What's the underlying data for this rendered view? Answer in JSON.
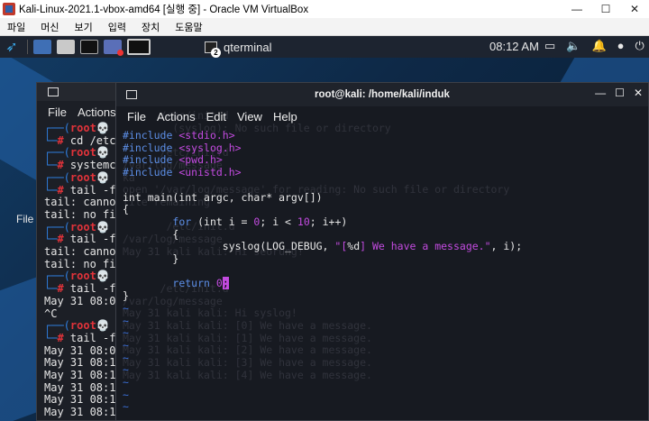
{
  "host": {
    "title": "Kali-Linux-2021.1-vbox-amd64 [실행 중] - Oracle VM VirtualBox",
    "controls": [
      "—",
      "☐",
      "✕"
    ]
  },
  "vbox_menu": [
    "파일",
    "머신",
    "보기",
    "입력",
    "장치",
    "도움말"
  ],
  "panel": {
    "task_label": "qterminal",
    "task_count": "2",
    "clock": "08:12 AM"
  },
  "desktop": {
    "label": "File"
  },
  "back_terminal": {
    "menu": [
      "File",
      "Actions"
    ],
    "lines": [
      "┌──(root💀 ka",
      "└─# cd /etc/",
      "┌──(root💀 ka",
      "└─# systemct",
      "┌──(root💀 ka",
      "└─# tail -f",
      "tail: cannot",
      "tail: no fil",
      "┌──(root💀 ka",
      "└─# tail -f",
      "tail: cannot",
      "tail: no fil",
      "┌──(root💀 ka",
      "└─# tail -f",
      "May 31 08:06",
      "^C",
      "┌──(root💀 ka",
      "└─# tail -f",
      "May 31 08:06",
      "May 31 08:11",
      "May 31 08:11",
      "May 31 08:11",
      "May 31 08:11",
      "May 31 08:11"
    ]
  },
  "front_terminal": {
    "title": "root@kali: /home/kali/induk",
    "menu": [
      "File",
      "Actions",
      "Edit",
      "View",
      "Help"
    ],
    "code": {
      "includes": [
        "<stdio.h>",
        "<syslog.h>",
        "<pwd.h>",
        "<unistd.h>"
      ],
      "include_kw": "#include",
      "main_sig": "int main(int argc, char* argv[])",
      "open_brace": "{",
      "for_kw": "for",
      "for_rest_a": " (int i = ",
      "for_zero": "0",
      "for_rest_b": "; i < ",
      "for_ten": "10",
      "for_rest_c": "; i++)",
      "syslog_call": "syslog(LOG_DEBUG, ",
      "syslog_str_a": "\"[",
      "syslog_fmt": "%d",
      "syslog_str_b": "] We have a message.\"",
      "syslog_tail": ", i);",
      "return_kw": "return",
      "return_val": "0",
      "return_semi": ";",
      "close_brace": "}"
    },
    "tilde_count": 9
  }
}
